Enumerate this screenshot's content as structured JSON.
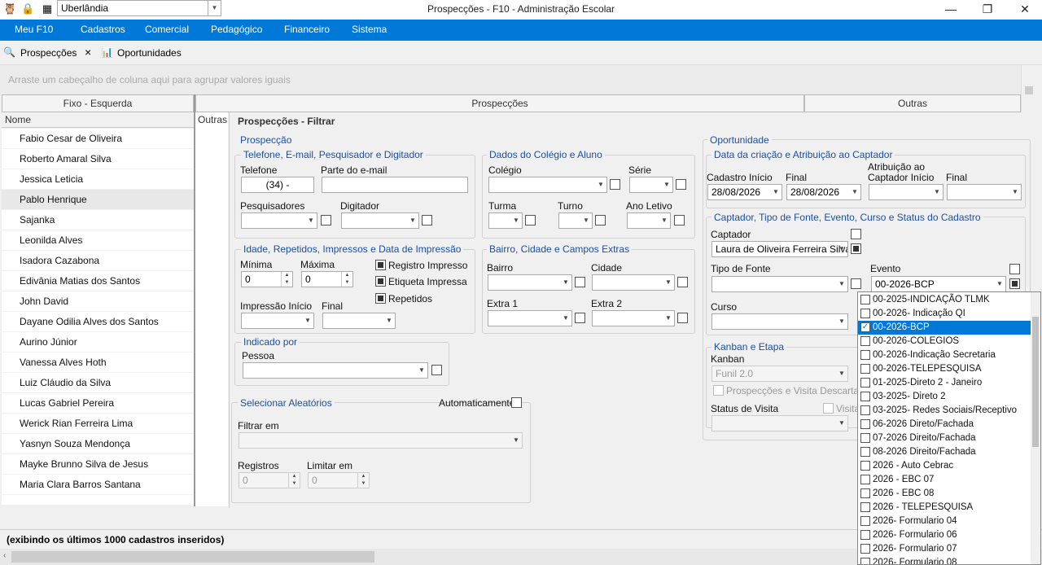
{
  "window": {
    "title": "Prospecções - F10 - Administração Escolar",
    "city": "Uberlândia",
    "minimize": "—",
    "maximize": "❐",
    "close": "✕"
  },
  "menu": [
    "Meu F10",
    "Cadastros",
    "Comercial",
    "Pedagógico",
    "Financeiro",
    "Sistema"
  ],
  "tabs": {
    "prospeccoes": "Prospecções",
    "oportunidades": "Oportunidades",
    "close": "×"
  },
  "grid": {
    "group_hint": "Arraste um cabeçalho de coluna aqui para agrupar valores iguais",
    "band_left": "Fixo - Esquerda",
    "band_mid": "Prospecções",
    "band_right": "Outras",
    "col_nome": "Nome",
    "col_outras": "Outras",
    "names": [
      "Fabio Cesar de Oliveira",
      "Roberto Amaral Silva",
      "Jessica Leticia",
      "Pablo Henrique",
      "Sajanka",
      "Leonilda Alves",
      "Isadora Cazabona",
      "Edivânia Matias dos Santos",
      "John David",
      "Dayane Odilia Alves dos Santos",
      "Aurino Júnior",
      "Vanessa Alves Hoth",
      "Luiz Cláudio da Silva",
      "Lucas Gabriel Pereira",
      "Werick Rian Ferreira Lima",
      "Yasnyn Souza Mendonça",
      "Mayke Brunno Silva de Jesus",
      "Maria Clara Barros Santana"
    ]
  },
  "filter": {
    "title": "Prospecções - Filtrar",
    "prospeccao": "Prospecção",
    "tel_group": "Telefone, E-mail, Pesquisador e Digitador",
    "telefone": "Telefone",
    "telefone_value": "(34)   -",
    "email": "Parte do e-mail",
    "pesquisadores": "Pesquisadores",
    "digitador": "Digitador",
    "colegio_group": "Dados do Colégio e Aluno",
    "colegio": "Colégio",
    "serie": "Série",
    "turma": "Turma",
    "turno": "Turno",
    "ano_letivo": "Ano Letivo",
    "idade_group": "Idade, Repetidos, Impressos e Data de Impressão",
    "minima": "Mínima",
    "maxima": "Máxima",
    "min_value": "0",
    "max_value": "0",
    "registro_impresso": "Registro Impresso",
    "etiqueta_impressa": "Etiqueta Impressa",
    "repetidos": "Repetidos",
    "impressao_inicio": "Impressão Início",
    "final": "Final",
    "bairro_group": "Bairro, Cidade e Campos Extras",
    "bairro": "Bairro",
    "cidade": "Cidade",
    "extra1": "Extra 1",
    "extra2": "Extra 2",
    "indicado_group": "Indicado por",
    "pessoa": "Pessoa",
    "aleatorios_group": "Selecionar Aleatórios",
    "automaticamente": "Automaticamente",
    "filtrar_em": "Filtrar em",
    "registros": "Registros",
    "limitar_em": "Limitar em",
    "registros_value": "0",
    "limitar_value": "0",
    "oportunidade": "Oportunidade",
    "data_group": "Data da criação e Atribuição ao Captador",
    "cadastro_inicio": "Cadastro Início",
    "final2": "Final",
    "atribuicao": "Atribuição ao",
    "captador_inicio": "Captador Início",
    "final3": "Final",
    "cad_inicio_value": "28/08/2026",
    "cad_final_value": "28/08/2026",
    "captador_group": "Captador, Tipo de Fonte, Evento, Curso e Status do Cadastro",
    "captador": "Captador",
    "captador_value": "Laura de Oliveira Ferreira Silva",
    "tipo_fonte": "Tipo de Fonte",
    "evento": "Evento",
    "evento_value": "00-2026-BCP",
    "curso": "Curso",
    "kanban_group": "Kanban e Etapa",
    "kanban": "Kanban",
    "kanban_value": "Funil 2.0",
    "prosp_visita": "Prospecções e Visita Descartados",
    "status_visita": "Status de Visita",
    "visita": "Visita"
  },
  "dropdown_items": [
    {
      "label": "00-2025-INDICAÇÃO TLMK",
      "checked": false,
      "selected": false
    },
    {
      "label": "00-2026- Indicação QI",
      "checked": false,
      "selected": false
    },
    {
      "label": "00-2026-BCP",
      "checked": true,
      "selected": true
    },
    {
      "label": "00-2026-COLEGIOS",
      "checked": false,
      "selected": false
    },
    {
      "label": "00-2026-Indicação Secretaria",
      "checked": false,
      "selected": false
    },
    {
      "label": "00-2026-TELEPESQUISA",
      "checked": false,
      "selected": false
    },
    {
      "label": "01-2025-Direto 2 - Janeiro",
      "checked": false,
      "selected": false
    },
    {
      "label": "03-2025- Direto 2",
      "checked": false,
      "selected": false
    },
    {
      "label": "03-2025- Redes Sociais/Receptivo",
      "checked": false,
      "selected": false
    },
    {
      "label": "06-2026 Direto/Fachada",
      "checked": false,
      "selected": false
    },
    {
      "label": "07-2026 Direito/Fachada",
      "checked": false,
      "selected": false
    },
    {
      "label": "08-2026 Direito/Fachada",
      "checked": false,
      "selected": false
    },
    {
      "label": "2026 - Auto Cebrac",
      "checked": false,
      "selected": false
    },
    {
      "label": "2026 - EBC 07",
      "checked": false,
      "selected": false
    },
    {
      "label": "2026 - EBC 08",
      "checked": false,
      "selected": false
    },
    {
      "label": "2026 - TELEPESQUISA",
      "checked": false,
      "selected": false
    },
    {
      "label": "2026- Formulario 04",
      "checked": false,
      "selected": false
    },
    {
      "label": "2026- Formulario 06",
      "checked": false,
      "selected": false
    },
    {
      "label": "2026- Formulario 07",
      "checked": false,
      "selected": false
    },
    {
      "label": "2026- Formulario 08",
      "checked": false,
      "selected": false
    }
  ],
  "status": "(exibindo os últimos 1000 cadastros inseridos)"
}
